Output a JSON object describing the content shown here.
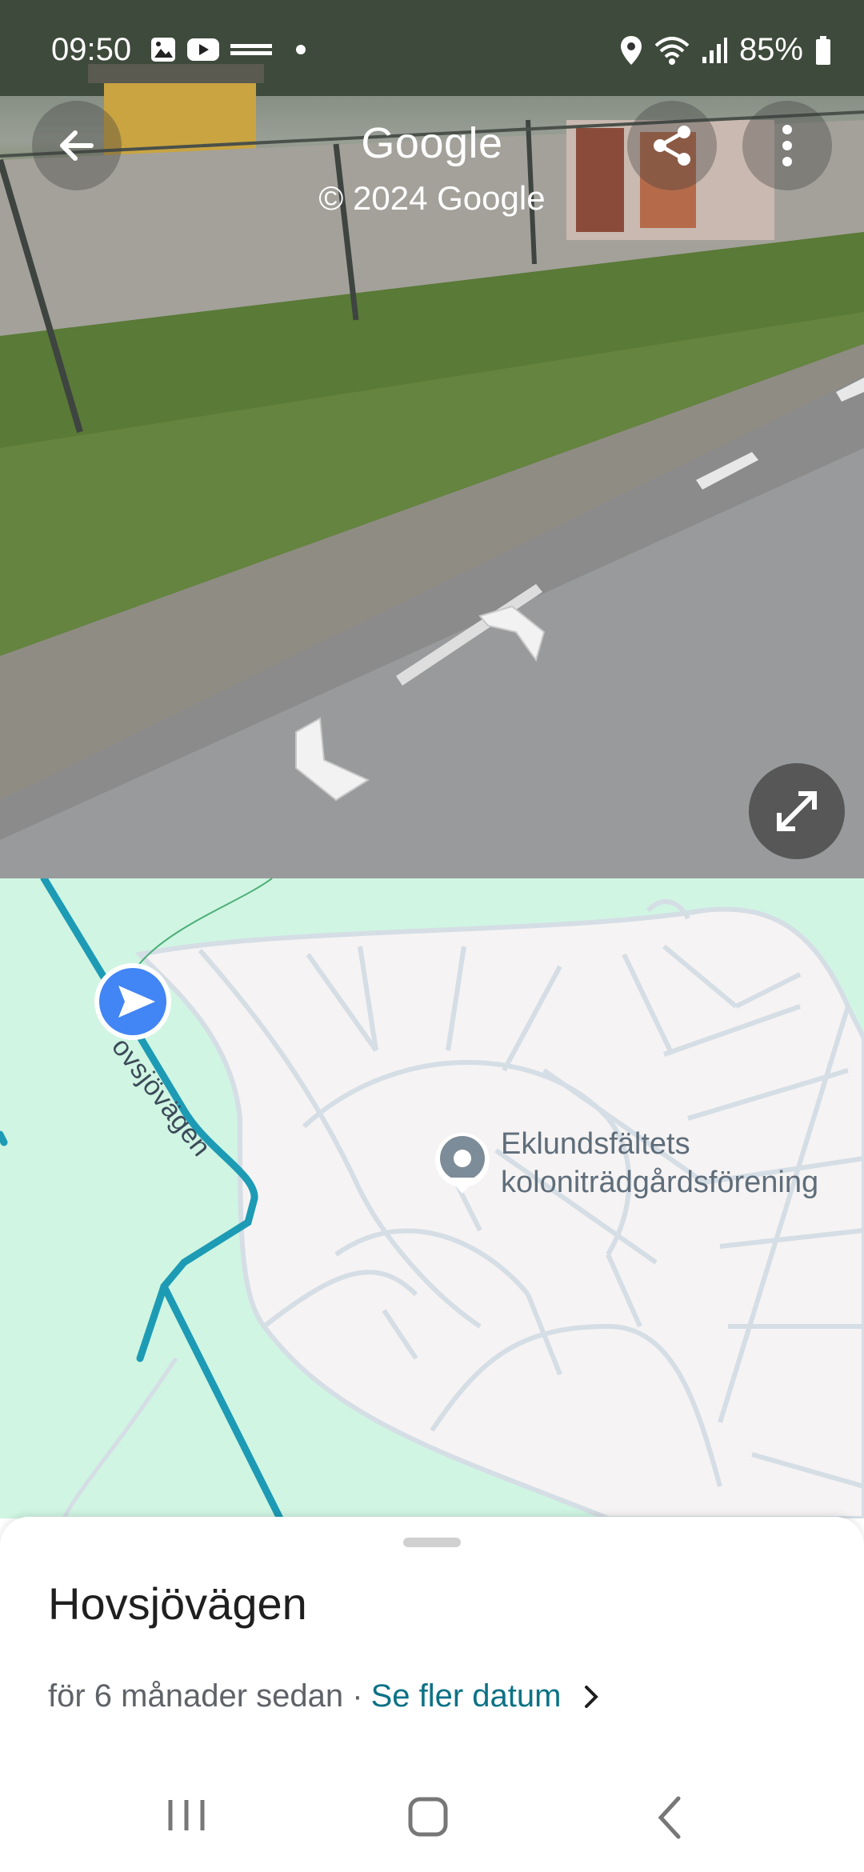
{
  "status_bar": {
    "time": "09:50",
    "battery": "85%",
    "icons_left": [
      "gallery-icon",
      "youtube-icon",
      "news-icon",
      "dot-icon"
    ],
    "icons_right": [
      "location-icon",
      "wifi-icon",
      "signal-icon",
      "battery-icon"
    ]
  },
  "street_view": {
    "title": "Google",
    "copyright": "© 2024 Google",
    "buttons": [
      "back-icon",
      "share-icon",
      "more-vert-icon",
      "expand-icon"
    ]
  },
  "map": {
    "road_label": "ovsjövägen",
    "poi_line1": "Eklundsfältets",
    "poi_line2": "koloniträdgårdsförening",
    "colors": {
      "park": "#d0f5e3",
      "area": "#f5f3f3",
      "roads": "#d5dde5",
      "route": "#1d9bb5",
      "marker": "#4285f4"
    }
  },
  "sheet": {
    "title": "Hovsjövägen",
    "subtitle": "för 6 månader sedan ·",
    "link": "Se fler datum"
  },
  "system_nav": [
    "recents-icon",
    "home-icon",
    "back-nav-icon"
  ]
}
